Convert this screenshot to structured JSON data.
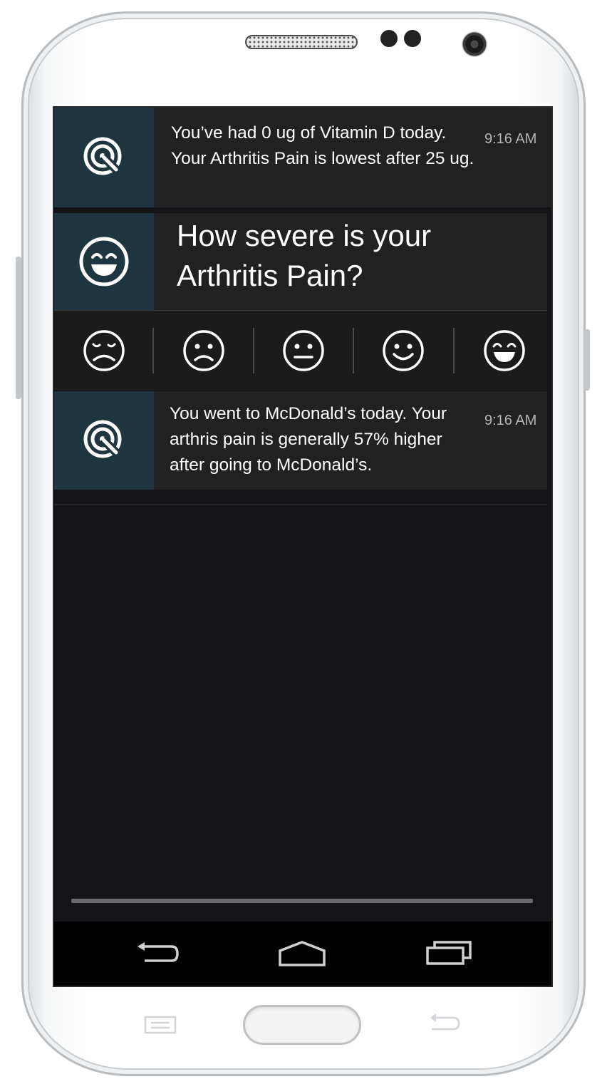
{
  "notifications": [
    {
      "icon": "target-cursor-icon",
      "text": "You’ve had 0 ug of Vitamin D today.  Your Arthritis Pain is lowest after 25 ug.",
      "time": "9:16 AM"
    },
    {
      "icon": "target-cursor-icon",
      "text": "You went to McDonald’s today. Your arthris pain is generally 57% higher after going to McDonald’s.",
      "time": "9:16 AM"
    }
  ],
  "question": {
    "icon": "laughing-face-icon",
    "text": "How severe is your Arthritis Pain?",
    "rating_options": [
      "very-sad-face-icon",
      "sad-face-icon",
      "neutral-face-icon",
      "smiling-face-icon",
      "laughing-face-icon"
    ]
  },
  "navbar": {
    "buttons": [
      "back-icon",
      "home-icon",
      "recent-apps-icon"
    ]
  },
  "hardware_keys": [
    "menu-key-icon",
    "home-key",
    "back-key-icon"
  ],
  "colors": {
    "icon_background": "#1f3640",
    "notification_background": "#212121",
    "shade_background": "#141317"
  }
}
